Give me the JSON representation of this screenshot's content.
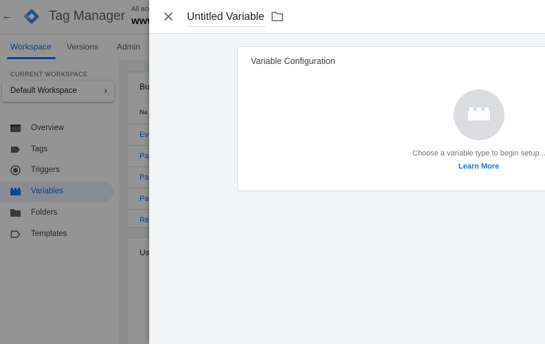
{
  "app": {
    "product_name": "Tag Manager",
    "account_label": "All acc",
    "container_name": "www"
  },
  "nav": {
    "tabs": [
      {
        "label": "Workspace",
        "active": true
      },
      {
        "label": "Versions",
        "active": false
      },
      {
        "label": "Admin",
        "active": false
      }
    ]
  },
  "sidebar": {
    "current_workspace_label": "CURRENT WORKSPACE",
    "workspace_name": "Default Workspace",
    "items": [
      {
        "label": "Overview",
        "icon": "overview-icon",
        "active": false
      },
      {
        "label": "Tags",
        "icon": "tag-icon",
        "active": false
      },
      {
        "label": "Triggers",
        "icon": "trigger-icon",
        "active": false
      },
      {
        "label": "Variables",
        "icon": "variables-icon",
        "active": true
      },
      {
        "label": "Folders",
        "icon": "folder-icon",
        "active": false
      },
      {
        "label": "Templates",
        "icon": "template-icon",
        "active": false
      }
    ]
  },
  "main": {
    "builtin_card_title": "Bu",
    "builtin_column_header": "Na",
    "builtin_rows": [
      "Eve",
      "Pag",
      "Pag",
      "Pag",
      "Ref"
    ],
    "user_card_title": "Us"
  },
  "sheet": {
    "title": "Untitled Variable",
    "config_title": "Variable Configuration",
    "hint": "Choose a variable type to begin setup...",
    "learn_more": "Learn More"
  },
  "colors": {
    "accent": "#1a73e8",
    "active_bg": "#e8f0fe",
    "sheet_bg": "#f1f3f4",
    "circle_bg": "#dadce0"
  }
}
